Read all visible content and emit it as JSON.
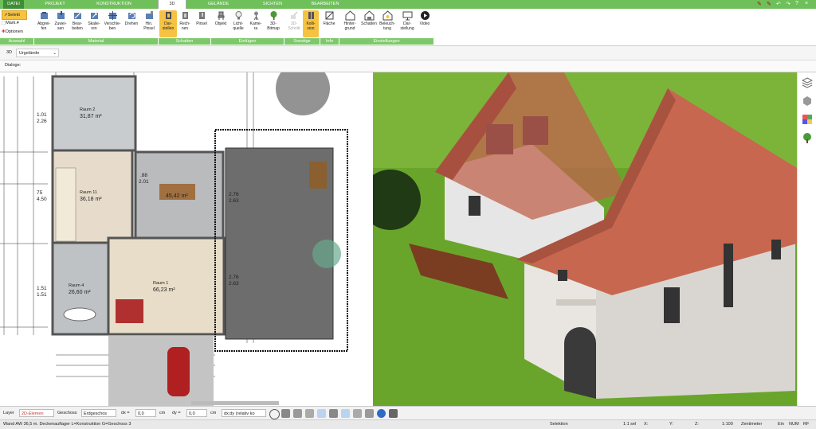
{
  "tabs": [
    "DATEI",
    "PROJEKT",
    "KONSTRUKTION",
    "3D",
    "GELÄNDE",
    "SICHTEN",
    "BEARBEITEN"
  ],
  "ribbon": {
    "auswahl": {
      "selekt": "Selekt",
      "mark": "Mark.",
      "optionen": "Optionen"
    },
    "material": [
      "Abgrei-\nfen",
      "Zuwei-\nsen",
      "Bear-\nbeiten",
      "Skalie-\nren",
      "Verschie-\nben",
      "Drehen",
      "Hin.\nPinsel"
    ],
    "schatten": [
      "Dar-\nstellen",
      "Rech-\nnen",
      "Pinsel"
    ],
    "einfuegen": [
      "Objekt",
      "Licht-\nquelle",
      "Kame-\nra",
      "3D-\nBitmap"
    ],
    "sonstige": [
      "3D-\nSchnitt",
      "Kolli-\nsion"
    ],
    "info": [
      "Fläche"
    ],
    "einstellungen": [
      "Hinter-\ngrund",
      "Schatten",
      "Beleuch-\ntung",
      "Dar-\nstellung",
      "Video"
    ],
    "groups": [
      "Auswahl",
      "Material",
      "Schatten",
      "Einfügen",
      "Sonstige",
      "Info",
      "Einstellungen"
    ]
  },
  "selector": {
    "mode": "3D",
    "value": "Urgelände"
  },
  "dialog_label": "Dialoge:",
  "rooms": [
    {
      "name": "Raum 2",
      "area": "31,87 m²"
    },
    {
      "name": "Raum 11",
      "area": "36,18 m²"
    },
    {
      "name": "",
      "area": "45,42 m²"
    },
    {
      "name": "Raum 1",
      "area": "66,23 m²"
    },
    {
      "name": "Raum 4",
      "area": "26,60 m²"
    }
  ],
  "dims": [
    "1.01",
    "2.26",
    "75",
    "4.50",
    "1.51",
    "1.51",
    ".88",
    "2.01",
    "2.76",
    "2.63",
    "2.76",
    "2.63"
  ],
  "statusbar": {
    "layer_label": "Layer",
    "layer_value": "2D-Elemen",
    "geschoss_label": "Geschoss",
    "geschoss_value": "Erdgeschos",
    "dx_label": "dx =",
    "dx_value": "0,0",
    "dx_unit": "cm",
    "dy_label": "dy =",
    "dy_value": "0,0",
    "dy_unit": "cm",
    "rel_value": "dx;dy (relativ ko"
  },
  "infobar": {
    "message": "Wand AW 36,5 m. Deckenauflager L=Konstruktion G=Geschoss 3",
    "selection": "Selektion",
    "scale_sel": "1:1 sel",
    "x": "X:",
    "y": "Y:",
    "z": "Z:",
    "scale": "1:100",
    "unit": "Zentimeter",
    "ein": "Ein",
    "num": "NUM",
    "rf": "RF"
  },
  "colors": {
    "accent": "#6fbf5a",
    "group": "#7dc86a",
    "active_btn": "#f5c242",
    "grass": "#6aa52b",
    "roof": "#c0634c"
  }
}
